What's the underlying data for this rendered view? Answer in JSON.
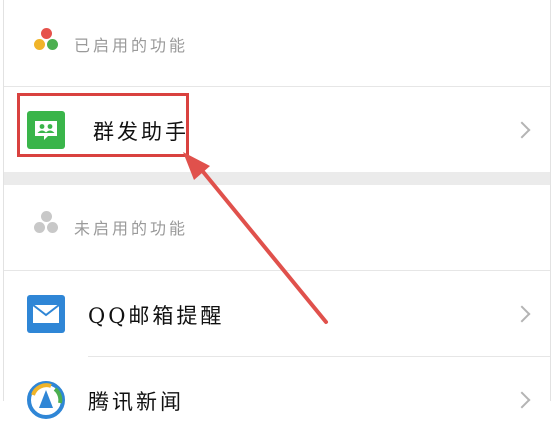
{
  "enabled_section": {
    "title": "已启用的功能"
  },
  "enabled_items": [
    {
      "label": "群发助手",
      "icon": "group-message-icon"
    }
  ],
  "disabled_section": {
    "title": "未启用的功能"
  },
  "disabled_items": [
    {
      "label": "QQ邮箱提醒",
      "icon": "mail-icon"
    },
    {
      "label": "腾讯新闻",
      "icon": "news-icon"
    }
  ],
  "colors": {
    "highlight": "#d9413f",
    "group_icon": "#3ab54a",
    "mail_icon": "#2f86d6",
    "dot_red": "#e6524b",
    "dot_yellow": "#f0b429",
    "dot_green": "#4caf50",
    "dot_gray": "#c8c8c8"
  }
}
